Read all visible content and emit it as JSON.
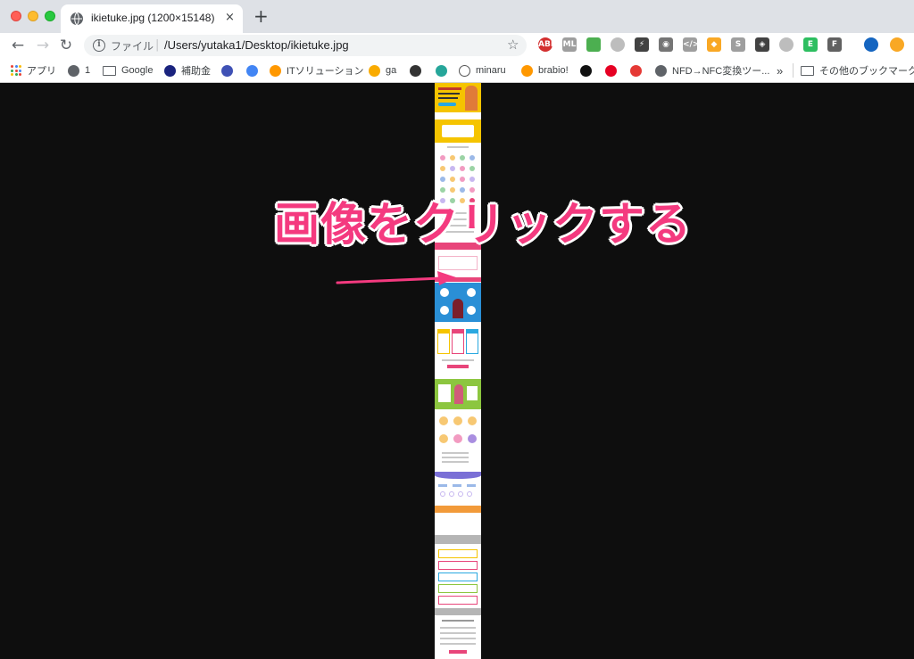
{
  "tab": {
    "title": "ikietuke.jpg (1200×15148)",
    "close_icon": "×",
    "new_tab_icon": "+"
  },
  "toolbar": {
    "back_icon": "←",
    "forward_icon": "→",
    "reload_icon": "↻",
    "scheme_label": "ファイル",
    "url": "/Users/yutaka1/Desktop/ikietuke.jpg",
    "bookmark_star_icon": "☆",
    "extensions": [
      {
        "name": "adblock-plus-icon",
        "label": "ABP",
        "color": "#d32f2f"
      },
      {
        "name": "ml-extension-icon",
        "label": "ML",
        "color": "#9e9e9e"
      },
      {
        "name": "color-wheel-icon",
        "label": "",
        "color": "#4caf50"
      },
      {
        "name": "gray-circle-icon",
        "label": "",
        "color": "#bdbdbd"
      },
      {
        "name": "lightning-icon",
        "label": "⚡",
        "color": "#424242"
      },
      {
        "name": "camera-icon",
        "label": "◉",
        "color": "#757575"
      },
      {
        "name": "code-icon",
        "label": "</>",
        "color": "#9e9e9e"
      },
      {
        "name": "compass-icon",
        "label": "◆",
        "color": "#f9a825"
      },
      {
        "name": "s-extension-icon",
        "label": "S",
        "color": "#9e9e9e"
      },
      {
        "name": "layers-icon",
        "label": "◈",
        "color": "#424242"
      },
      {
        "name": "globe-gray-icon",
        "label": "",
        "color": "#bdbdbd"
      },
      {
        "name": "evernote-icon",
        "label": "E",
        "color": "#2dbe60"
      },
      {
        "name": "puzzle-icon",
        "label": "F",
        "color": "#616161"
      },
      {
        "name": "profile-avatar-icon",
        "label": "",
        "color": "#1565c0"
      },
      {
        "name": "update-icon",
        "label": "",
        "color": "#f9a825"
      }
    ]
  },
  "bookmarks": {
    "apps_label": "アプリ",
    "items": [
      {
        "name": "bookmark-1",
        "label": "1",
        "icon_color": "#5f6368"
      },
      {
        "name": "bookmark-google-folder",
        "label": "Google",
        "folder": true
      },
      {
        "name": "bookmark-hojokin",
        "label": "補助金",
        "icon_color": "#1a237e"
      },
      {
        "name": "bookmark-c",
        "label": "",
        "icon_color": "#3f51b5"
      },
      {
        "name": "bookmark-g",
        "label": "",
        "icon_color": "#4285f4"
      },
      {
        "name": "bookmark-it-solution",
        "label": "ITソリューション",
        "icon_color": "#ff9800"
      },
      {
        "name": "bookmark-ga",
        "label": "ga",
        "icon_color": "#f9ab00"
      },
      {
        "name": "bookmark-panda",
        "label": "",
        "icon_color": "#333333"
      },
      {
        "name": "bookmark-cloud",
        "label": "",
        "icon_color": "#26a69a"
      },
      {
        "name": "bookmark-minaru",
        "label": "minaru",
        "icon_color": "#ffffff"
      },
      {
        "name": "bookmark-brabio",
        "label": "brabio!",
        "icon_color": "#ff9800"
      },
      {
        "name": "bookmark-l",
        "label": "",
        "icon_color": "#111111"
      },
      {
        "name": "bookmark-pinterest",
        "label": "",
        "icon_color": "#e60023"
      },
      {
        "name": "bookmark-flower",
        "label": "",
        "icon_color": "#e53935"
      },
      {
        "name": "bookmark-nfd",
        "label": "NFD→NFC変換ツー...",
        "icon_color": "#5f6368"
      }
    ],
    "overflow_label": "»",
    "other_label": "その他のブックマーク"
  },
  "annotation": {
    "text": "画像をクリックする",
    "color": "#f43a7f"
  }
}
